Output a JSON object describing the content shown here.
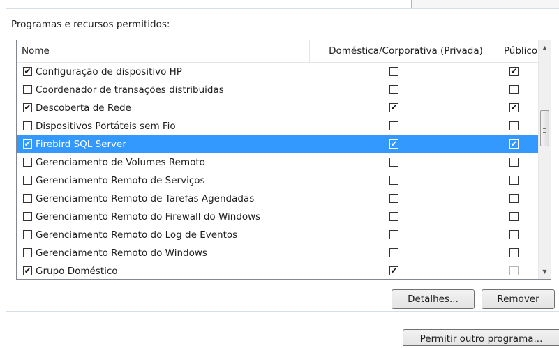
{
  "group": {
    "label": "Programas e recursos permitidos:"
  },
  "columns": {
    "name": "Nome",
    "private": "Doméstica/Corporativa (Privada)",
    "public": "Público"
  },
  "rows": [
    {
      "name": "Configuração de dispositivo HP",
      "enabled": true,
      "private": false,
      "public": true,
      "selected": false
    },
    {
      "name": "Coordenador de transações distribuídas",
      "enabled": false,
      "private": false,
      "public": false,
      "selected": false
    },
    {
      "name": "Descoberta de Rede",
      "enabled": true,
      "private": true,
      "public": true,
      "selected": false
    },
    {
      "name": "Dispositivos Portáteis sem Fio",
      "enabled": false,
      "private": false,
      "public": false,
      "selected": false
    },
    {
      "name": "Firebird SQL Server",
      "enabled": true,
      "private": true,
      "public": true,
      "selected": true
    },
    {
      "name": "Gerenciamento de Volumes Remoto",
      "enabled": false,
      "private": false,
      "public": false,
      "selected": false
    },
    {
      "name": "Gerenciamento Remoto de Serviços",
      "enabled": false,
      "private": false,
      "public": false,
      "selected": false
    },
    {
      "name": "Gerenciamento Remoto de Tarefas Agendadas",
      "enabled": false,
      "private": false,
      "public": false,
      "selected": false
    },
    {
      "name": "Gerenciamento Remoto do Firewall do Windows",
      "enabled": false,
      "private": false,
      "public": false,
      "selected": false
    },
    {
      "name": "Gerenciamento Remoto do Log de Eventos",
      "enabled": false,
      "private": false,
      "public": false,
      "selected": false
    },
    {
      "name": "Gerenciamento Remoto do Windows",
      "enabled": false,
      "private": false,
      "public": false,
      "selected": false
    },
    {
      "name": "Grupo Doméstico",
      "enabled": true,
      "private": true,
      "public": false,
      "public_disabled": true,
      "selected": false
    }
  ],
  "buttons": {
    "details": "Detalhes...",
    "remove": "Remover",
    "allow_other": "Permitir outro programa..."
  },
  "colors": {
    "selection": "#3399ff"
  }
}
